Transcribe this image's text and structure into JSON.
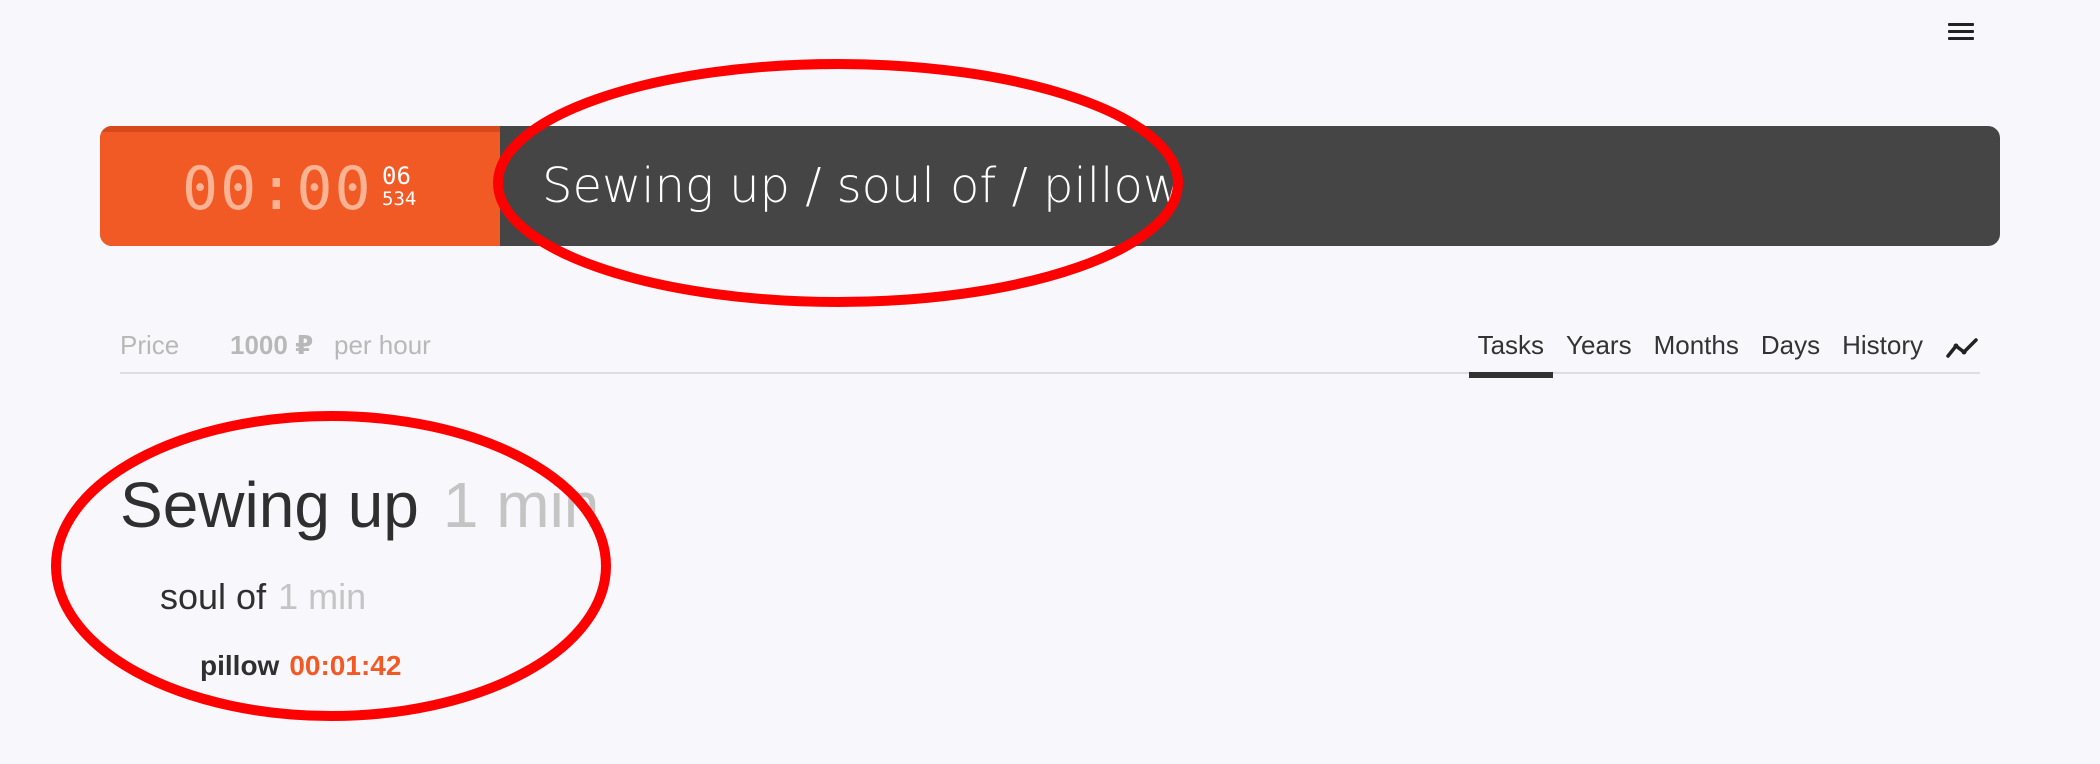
{
  "menu": {
    "icon": "hamburger-icon"
  },
  "timer": {
    "main": "00:00",
    "seconds": "06",
    "ms": "534",
    "bg_color": "#f25a25"
  },
  "current_task": {
    "path": "Sewing up / soul of / pillow"
  },
  "price": {
    "label": "Price",
    "value": "1000 ₽",
    "unit": "per hour"
  },
  "tabs": [
    {
      "label": "Tasks",
      "active": true
    },
    {
      "label": "Years",
      "active": false
    },
    {
      "label": "Months",
      "active": false
    },
    {
      "label": "Days",
      "active": false
    },
    {
      "label": "History",
      "active": false
    }
  ],
  "chart_icon": "trend-chart-icon",
  "tree": {
    "level1": {
      "name": "Sewing up",
      "time": "1 min"
    },
    "level2": {
      "name": "soul of",
      "time": "1 min"
    },
    "level3": {
      "name": "pillow",
      "time": "00:01:42"
    }
  },
  "colors": {
    "accent": "#f25a25",
    "dark_bar": "#454545",
    "annotation": "#ff0000"
  }
}
